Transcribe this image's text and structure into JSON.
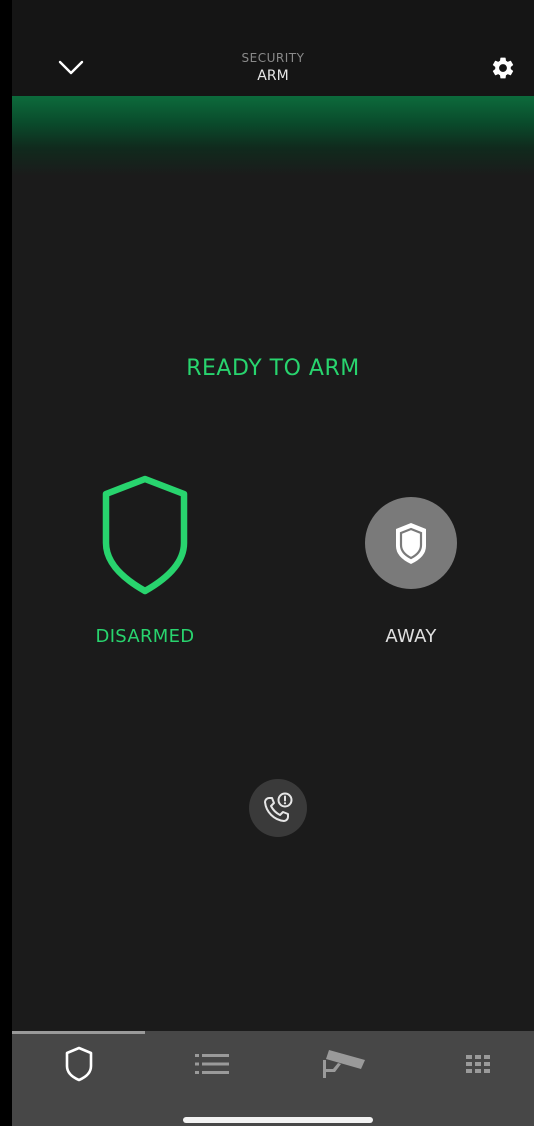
{
  "header": {
    "subtitle": "SECURITY",
    "title": "ARM",
    "back_icon": "chevron-down-icon",
    "settings_icon": "gear-icon"
  },
  "status": {
    "text": "READY TO ARM",
    "color": "#28d46e"
  },
  "modes": [
    {
      "label": "DISARMED",
      "icon": "shield-outline-icon",
      "active": true,
      "color": "#28d46e"
    },
    {
      "label": "AWAY",
      "icon": "shield-filled-icon",
      "active": false,
      "color": "#e0e0e0"
    }
  ],
  "emergency": {
    "icon": "phone-alert-icon"
  },
  "nav": {
    "items": [
      {
        "icon": "shield-icon",
        "active": true
      },
      {
        "icon": "list-icon",
        "active": false
      },
      {
        "icon": "camera-icon",
        "active": false
      },
      {
        "icon": "keypad-icon",
        "active": false
      }
    ]
  },
  "colors": {
    "accent": "#28d46e",
    "background": "#1b1b1b",
    "nav_background": "#474747"
  }
}
